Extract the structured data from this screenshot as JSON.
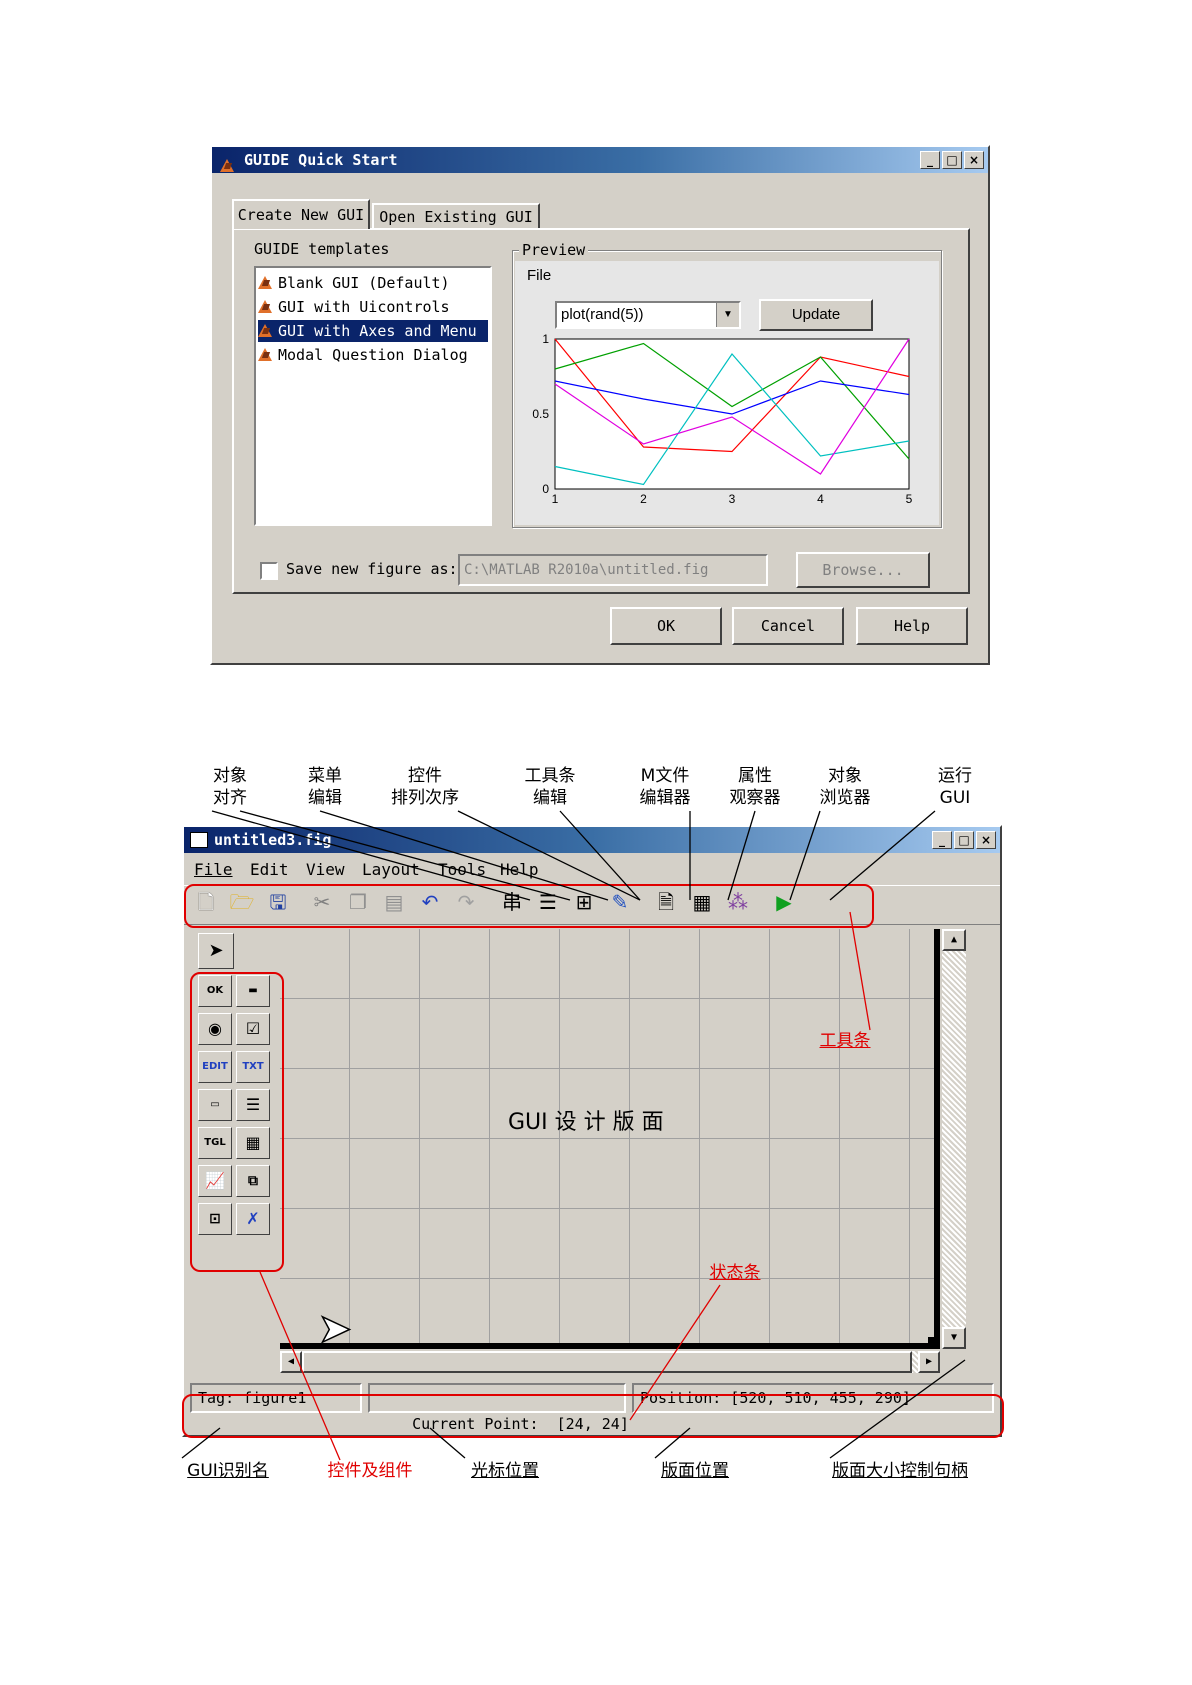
{
  "quickstart": {
    "title": "GUIDE Quick Start",
    "tabs": [
      "Create New GUI",
      "Open Existing GUI"
    ],
    "templates_label": "GUIDE templates",
    "templates": [
      "Blank GUI (Default)",
      "GUI with Uicontrols",
      "GUI with Axes and Menu",
      "Modal Question Dialog"
    ],
    "selected_template": "GUI with Axes and Menu",
    "preview_label": "Preview",
    "preview_menu": "File",
    "plot_select_value": "plot(rand(5))",
    "update_label": "Update",
    "save_checkbox_label": "Save new figure as:",
    "save_path_value": "C:\\MATLAB R2010a\\untitled.fig",
    "browse_label": "Browse...",
    "ok_label": "OK",
    "cancel_label": "Cancel",
    "help_label": "Help",
    "preview_chart": {
      "y_ticks": [
        "1",
        "0.5",
        "0"
      ],
      "x_ticks": [
        "1",
        "2",
        "3",
        "4",
        "5"
      ]
    }
  },
  "chart_data": {
    "type": "line",
    "title": "",
    "x": [
      1,
      2,
      3,
      4,
      5
    ],
    "ylim": [
      0,
      1
    ],
    "xlim": [
      1,
      5
    ],
    "series": [
      {
        "color": "#ff0000",
        "values": [
          1.0,
          0.28,
          0.25,
          0.88,
          0.75
        ]
      },
      {
        "color": "#00a000",
        "values": [
          0.8,
          0.97,
          0.55,
          0.88,
          0.2
        ]
      },
      {
        "color": "#0000ff",
        "values": [
          0.72,
          0.6,
          0.5,
          0.72,
          0.63
        ]
      },
      {
        "color": "#00c0c0",
        "values": [
          0.15,
          0.03,
          0.9,
          0.22,
          0.32
        ]
      },
      {
        "color": "#e000e0",
        "values": [
          0.7,
          0.3,
          0.48,
          0.1,
          1.0
        ]
      }
    ]
  },
  "editor": {
    "title": "untitled3.fig",
    "menu": [
      "File",
      "Edit",
      "View",
      "Layout",
      "Tools",
      "Help"
    ],
    "canvas_label": "GUI 设 计 版 面",
    "status_tag": "Tag: figure1",
    "status_point": "Current Point:  [24, 24]",
    "status_position": "Position: [520, 510, 455, 290]"
  },
  "annotations": {
    "top": [
      "对象\n对齐",
      "菜单\n编辑",
      "控件\n排列次序",
      "工具条\n编辑",
      "M文件\n编辑器",
      "属性\n观察器",
      "对象\n浏览器",
      "运行\nGUI"
    ],
    "toolbar": "工具条",
    "statusbar": "状态条",
    "bottom": [
      "GUI识别名",
      "控件及组件",
      "光标位置",
      "版面位置",
      "版面大小控制句柄"
    ]
  },
  "colors": {
    "win_face": "#d4d0c8",
    "title_start": "#0a246a",
    "title_end": "#a6caf0",
    "annotation_red": "#e00000"
  },
  "icons": [
    "new-file-icon",
    "open-folder-icon",
    "save-icon",
    "cut-icon",
    "copy-icon",
    "paste-icon",
    "undo-icon",
    "redo-icon",
    "align-objects-icon",
    "menu-editor-icon",
    "tab-order-icon",
    "toolbar-editor-icon",
    "mfile-editor-icon",
    "property-inspector-icon",
    "object-browser-icon",
    "run-icon"
  ]
}
